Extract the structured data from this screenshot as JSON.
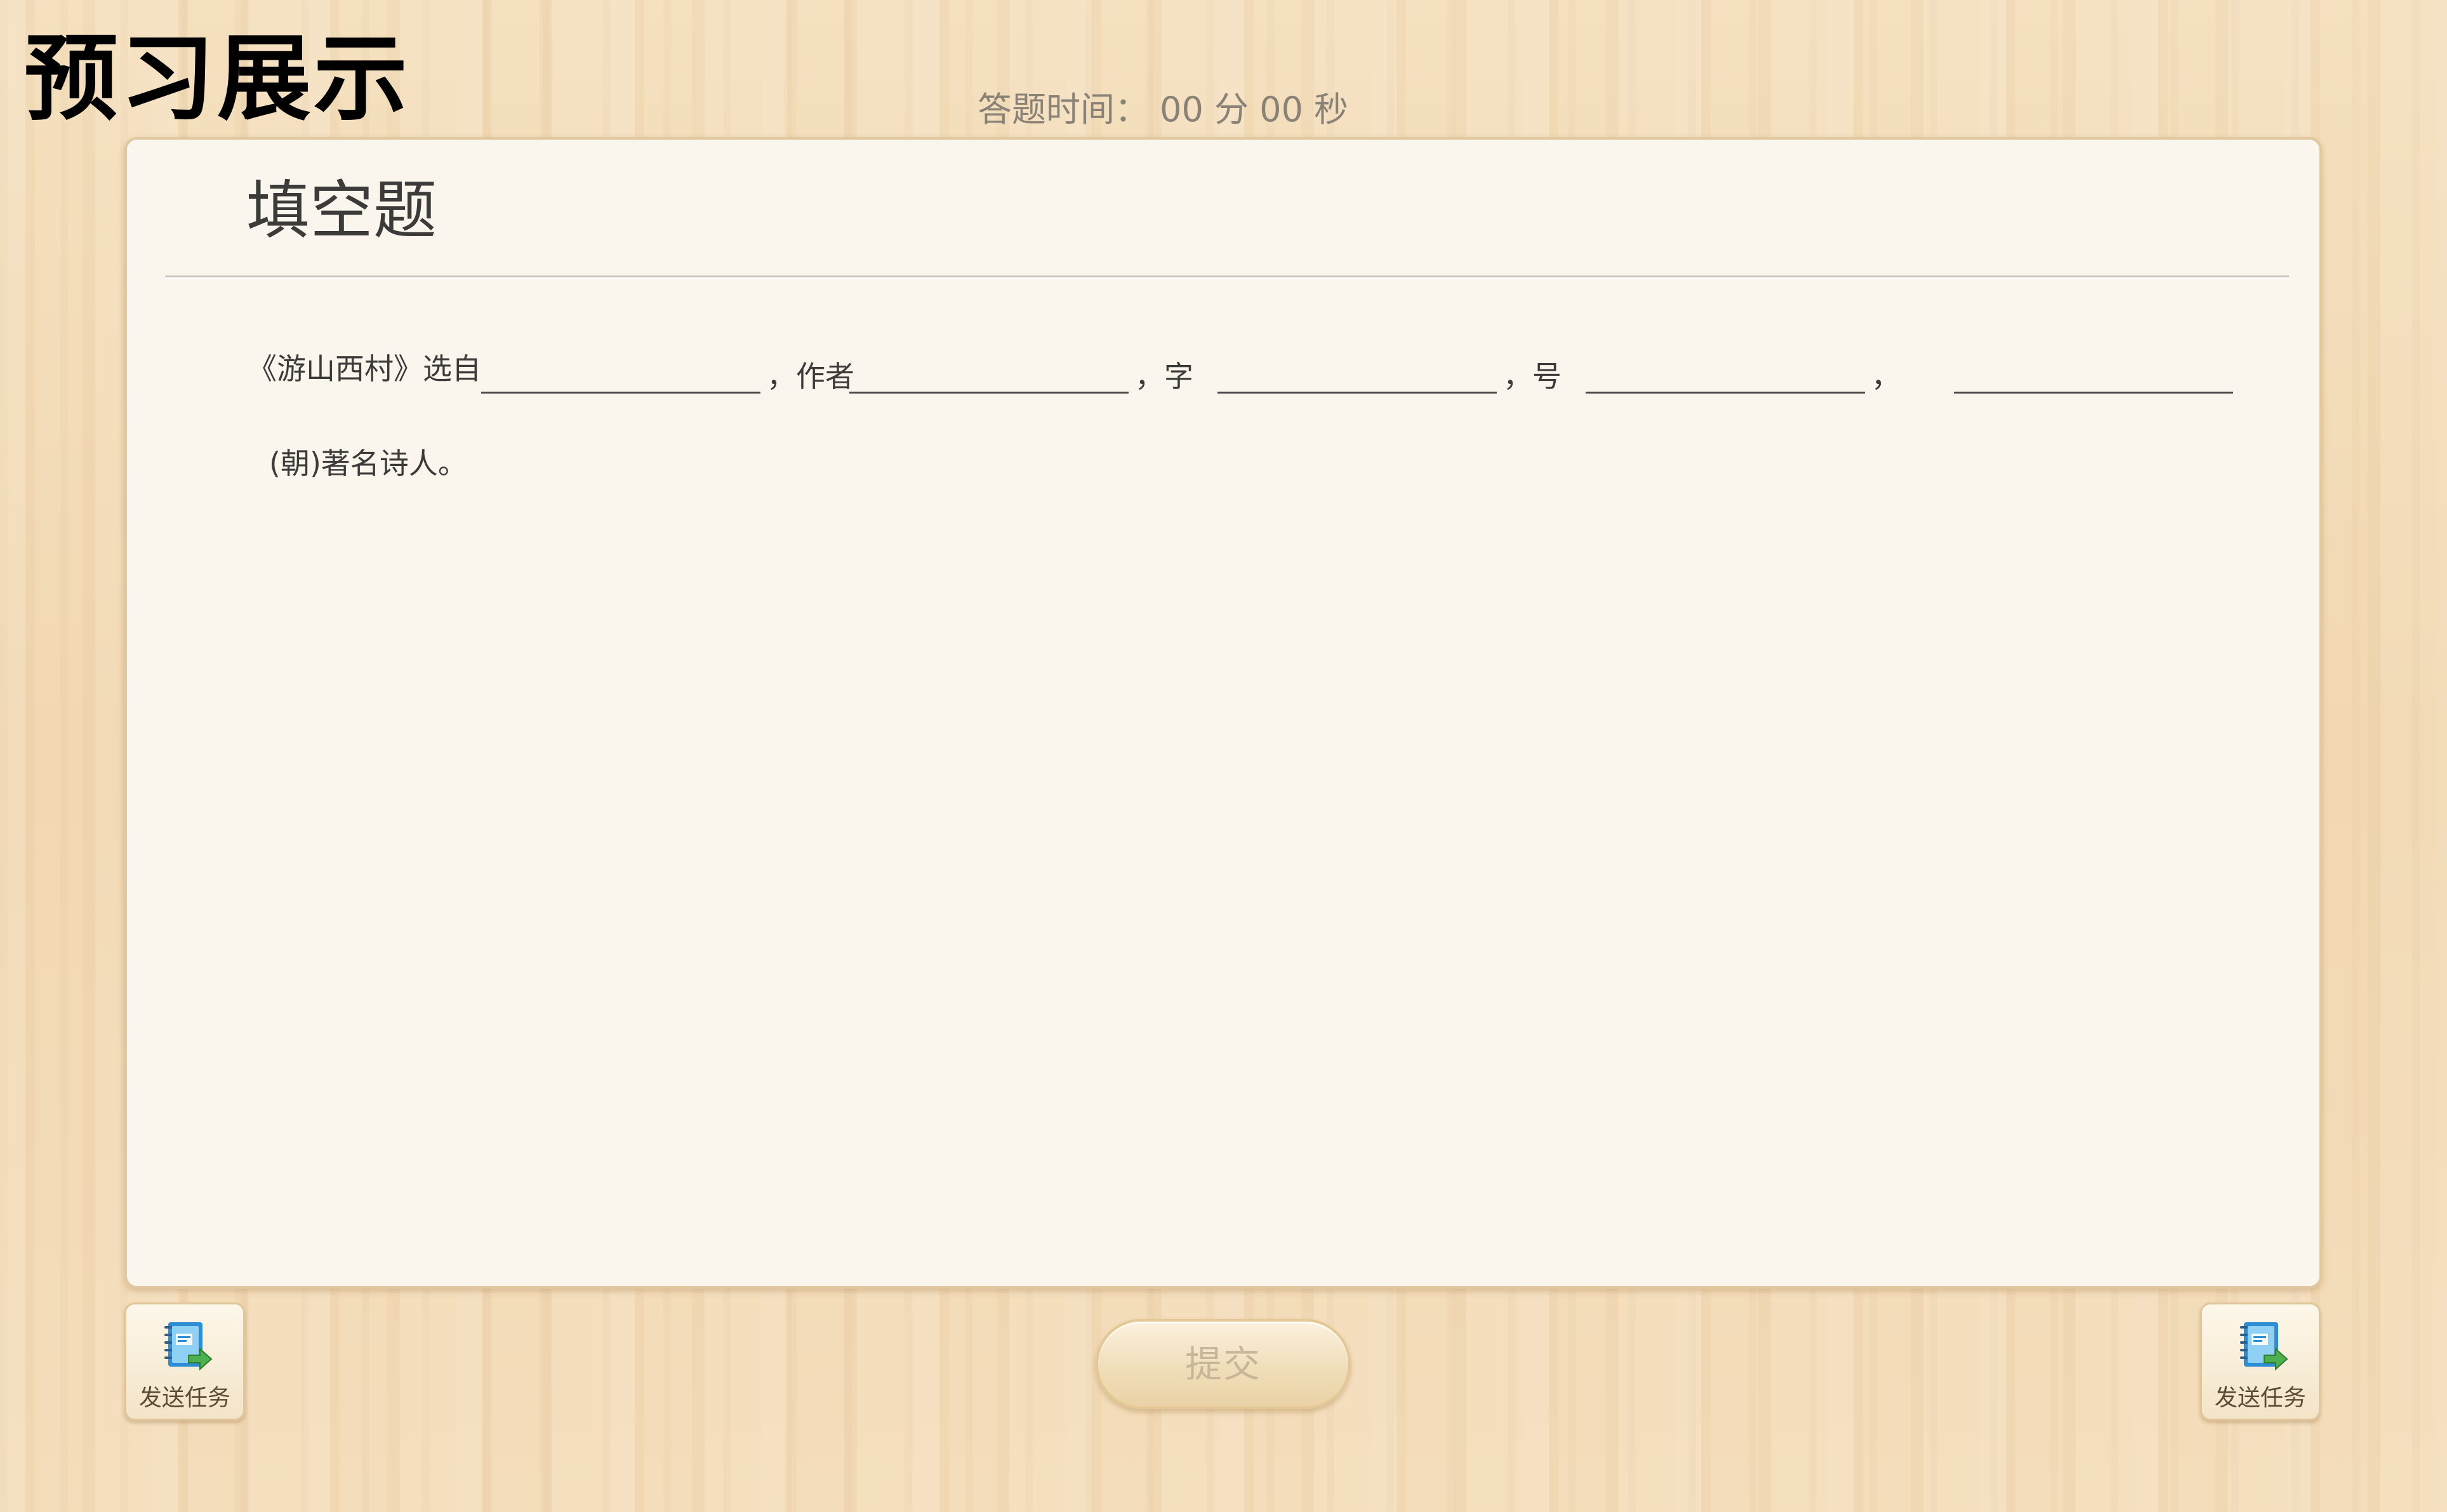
{
  "header": {
    "title": "预习展示",
    "timer_text": "答题时间： 00 分 00 秒"
  },
  "card": {
    "title": "填空题",
    "question": {
      "segments": [
        "《游山西村》选自",
        "，作者",
        "，字",
        "，号",
        "，"
      ],
      "blank_values": [
        "",
        "",
        "",
        "",
        ""
      ],
      "second_line": "(朝)著名诗人。"
    }
  },
  "footer": {
    "left_button_label": "发送任务",
    "submit_label": "提交",
    "right_button_label": "发送任务",
    "task_icon": "notebook-send-icon"
  },
  "colors": {
    "background": "#f3dcb8",
    "card": "#faf6ee",
    "accent_green": "#4caf50",
    "icon_blue": "#2d8ed6"
  }
}
